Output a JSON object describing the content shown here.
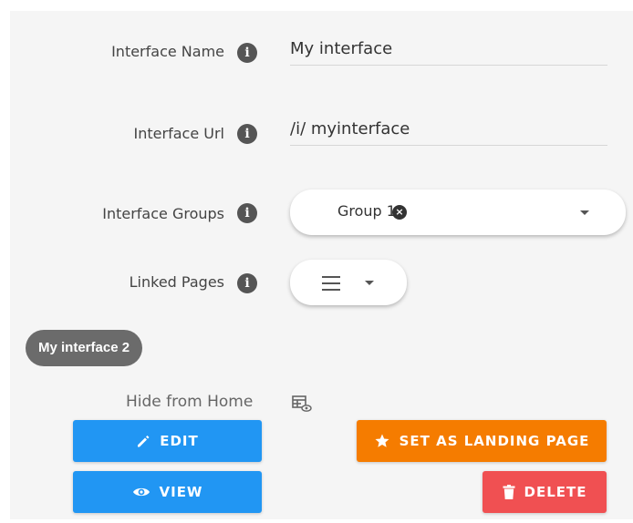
{
  "form": {
    "name_label": "Interface Name",
    "name_value": "My interface",
    "url_label": "Interface Url",
    "url_value": "/i/ myinterface",
    "groups_label": "Interface Groups",
    "group_chip": "Group 1",
    "pages_label": "Linked Pages",
    "info_glyph": "i"
  },
  "badge": {
    "label": "My interface 2"
  },
  "hide": {
    "label": "Hide from Home"
  },
  "actions": {
    "edit": "EDIT",
    "view": "VIEW",
    "landing": "SET AS LANDING PAGE",
    "delete": "DELETE"
  },
  "colors": {
    "primary": "#2196f3",
    "landing": "#f57c00",
    "danger": "#f05052",
    "badge": "#6b6b6b"
  },
  "icons": [
    "info-icon",
    "chip-close-icon",
    "dropdown-caret-icon",
    "hamburger-icon",
    "hide-home-icon",
    "pencil-icon",
    "eye-icon",
    "star-icon",
    "trash-icon"
  ]
}
